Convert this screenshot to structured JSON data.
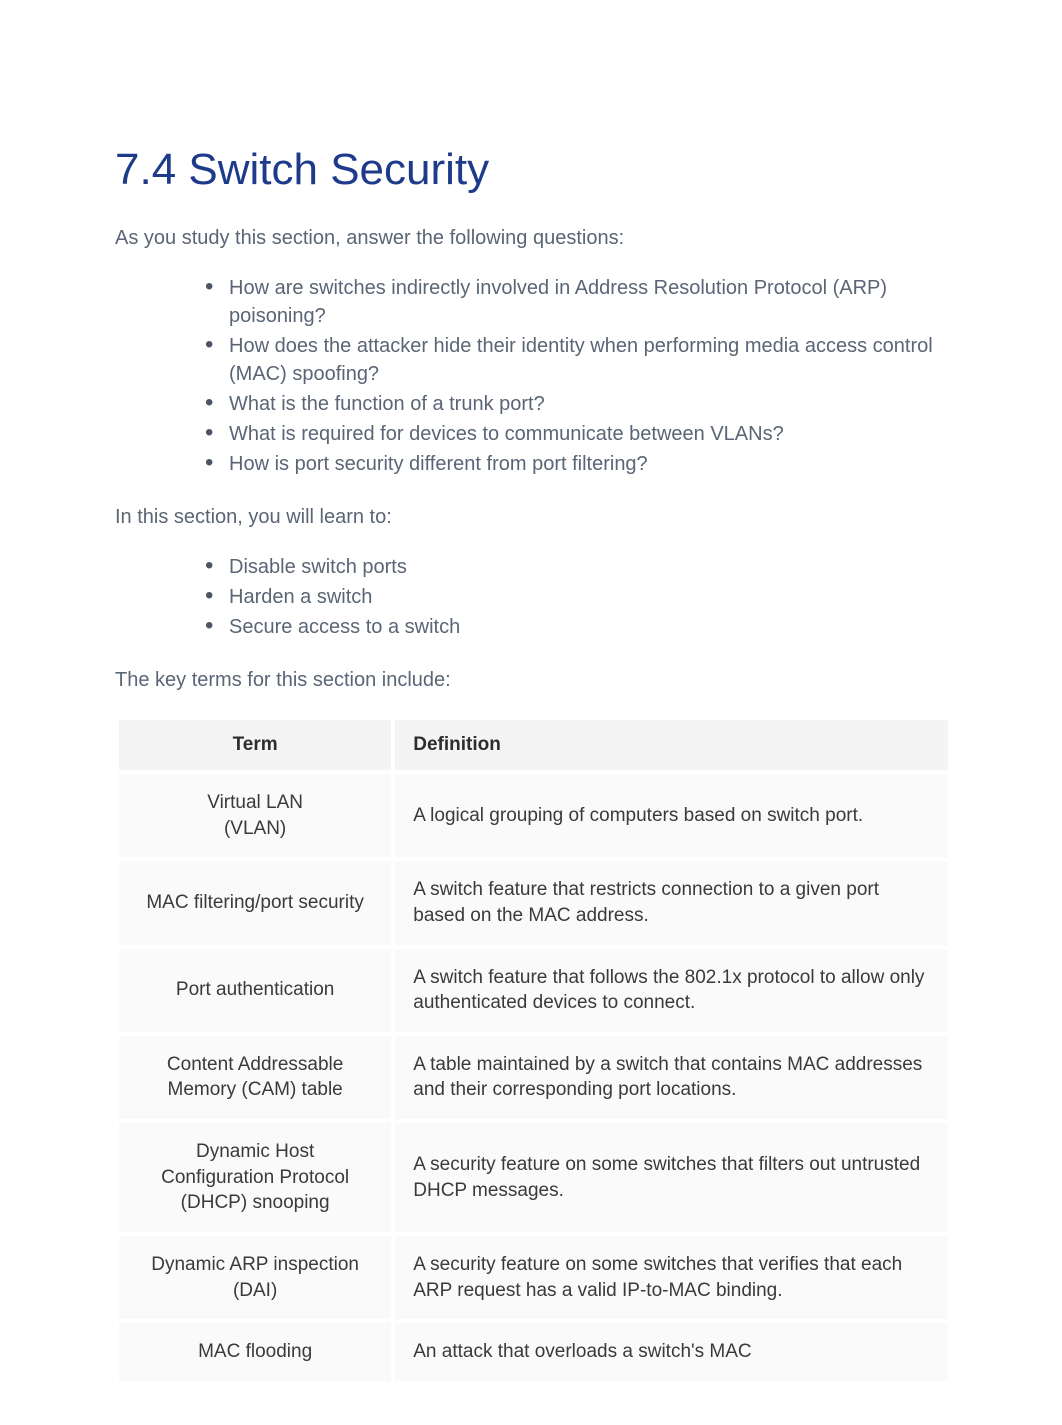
{
  "title": "7.4 Switch Security",
  "intro1": "As you study this section, answer the following questions:",
  "questions": [
    "How are switches indirectly involved in Address Resolution Protocol (ARP) poisoning?",
    "How does the attacker hide their identity when performing media access control (MAC) spoofing?",
    "What is the function of a trunk port?",
    "What is required for devices to communicate between VLANs?",
    "How is port security different from port filtering?"
  ],
  "intro2": "In this section, you will learn to:",
  "objectives": [
    "Disable switch ports",
    "Harden a switch",
    "Secure access to a switch"
  ],
  "intro3": "The key terms for this section include:",
  "tableHeaders": {
    "term": "Term",
    "definition": "Definition"
  },
  "terms": [
    {
      "term": "Virtual LAN\n(VLAN)",
      "definition": "A logical grouping of computers based on switch port."
    },
    {
      "term": "MAC filtering/port security",
      "definition": "A switch feature that restricts connection to a given port based on the MAC address."
    },
    {
      "term": "Port authentication",
      "definition": "A switch feature that follows the 802.1x protocol to allow only authenticated devices to connect."
    },
    {
      "term": "Content Addressable Memory (CAM) table",
      "definition": "A table maintained by a switch that contains MAC addresses and their corresponding port locations."
    },
    {
      "term": "Dynamic Host Configuration Protocol (DHCP) snooping",
      "definition": "A security feature on some switches that filters out untrusted DHCP messages."
    },
    {
      "term": "Dynamic ARP inspection (DAI)",
      "definition": "A security feature on some switches that verifies that each ARP request has a valid IP-to-MAC binding."
    },
    {
      "term": "MAC flooding",
      "definition": "An attack that overloads a switch's MAC"
    }
  ]
}
